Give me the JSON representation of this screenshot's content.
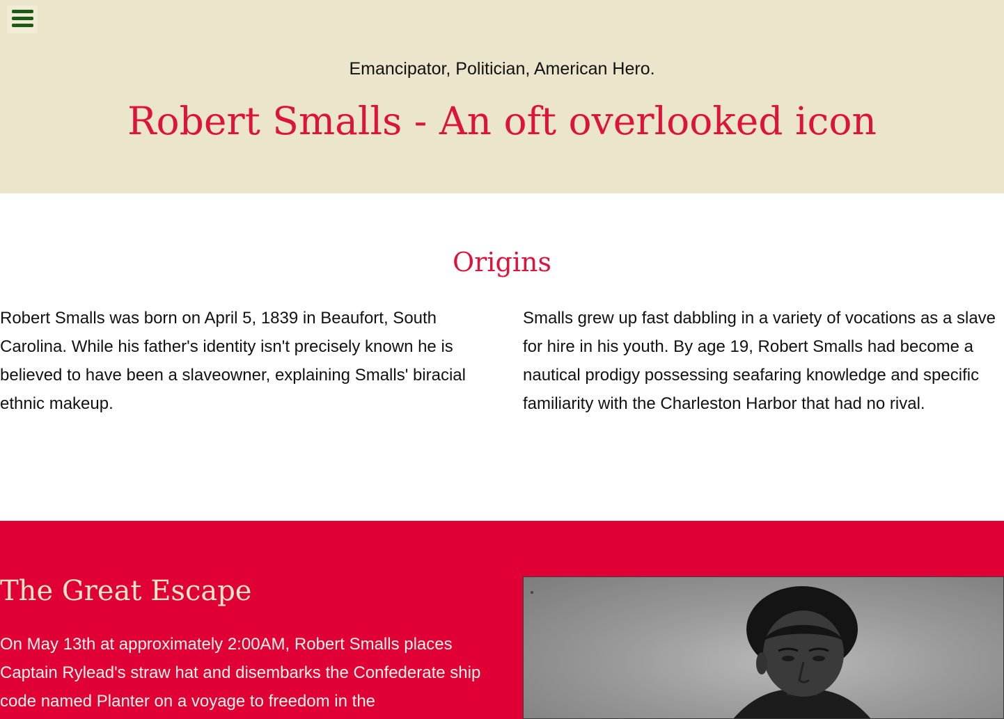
{
  "hero": {
    "menu_icon": "hamburger-menu-icon",
    "tagline": "Emancipator, Politician, American Hero.",
    "title": "Robert Smalls - An oft overlooked icon"
  },
  "origins": {
    "heading": "Origins",
    "left_paragraph": "Robert Smalls was born on April 5, 1839 in Beaufort, South Carolina. While his father's identity isn't precisely known he is believed to have been a slaveowner, explaining Smalls' biracial ethnic makeup.",
    "right_paragraph": "Smalls grew up fast dabbling in a variety of vocations as a slave for hire in his youth. By age 19, Robert Smalls had become a nautical prodigy possessing seafaring knowledge and specific familiarity with the Charleston Harbor that had no rival."
  },
  "escape": {
    "heading": "The Great Escape",
    "paragraph": "On May 13th at approximately 2:00AM, Robert Smalls places Captain Rylead's straw hat and disembarks the Confederate ship code named Planter on a voyage to freedom in the",
    "image_subject": "portrait-photo"
  },
  "colors": {
    "hero_bg": "#ebe5cb",
    "accent_red": "#dc143c",
    "escape_bg": "#e10035",
    "menu_icon": "#1e5a17",
    "cream_heading": "#f2e6c4"
  }
}
